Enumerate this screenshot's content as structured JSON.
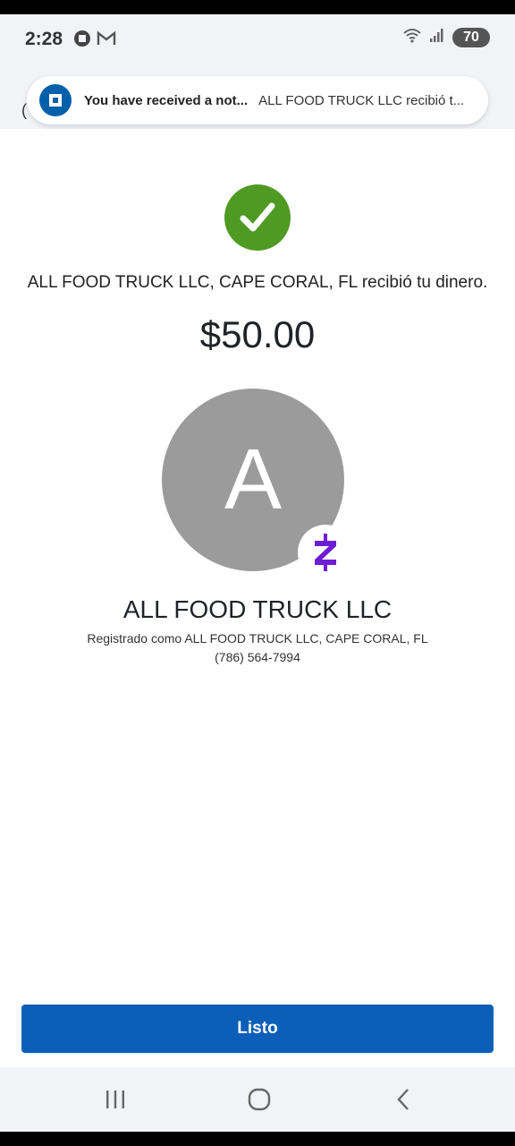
{
  "status": {
    "time": "2:28",
    "battery": "70"
  },
  "notification": {
    "title": "You have received a not...",
    "body": "ALL FOOD TRUCK LLC recibió t..."
  },
  "confirmation": {
    "message": "ALL FOOD TRUCK LLC, CAPE CORAL, FL recibió tu dinero.",
    "amount": "$50.00"
  },
  "recipient": {
    "initial": "A",
    "name": "ALL FOOD TRUCK LLC",
    "registered_as": "Registrado como ALL FOOD TRUCK LLC, CAPE CORAL, FL",
    "phone": "(786) 564-7994"
  },
  "actions": {
    "done_label": "Listo"
  },
  "colors": {
    "success": "#4f9a23",
    "primary": "#0b5fb8",
    "zelle": "#6d1ed4"
  },
  "icons": [
    "chase-app-icon",
    "gmail-icon",
    "wifi-icon",
    "signal-icon",
    "battery-icon",
    "checkmark-icon",
    "zelle-icon",
    "recents-icon",
    "home-icon",
    "back-icon"
  ]
}
